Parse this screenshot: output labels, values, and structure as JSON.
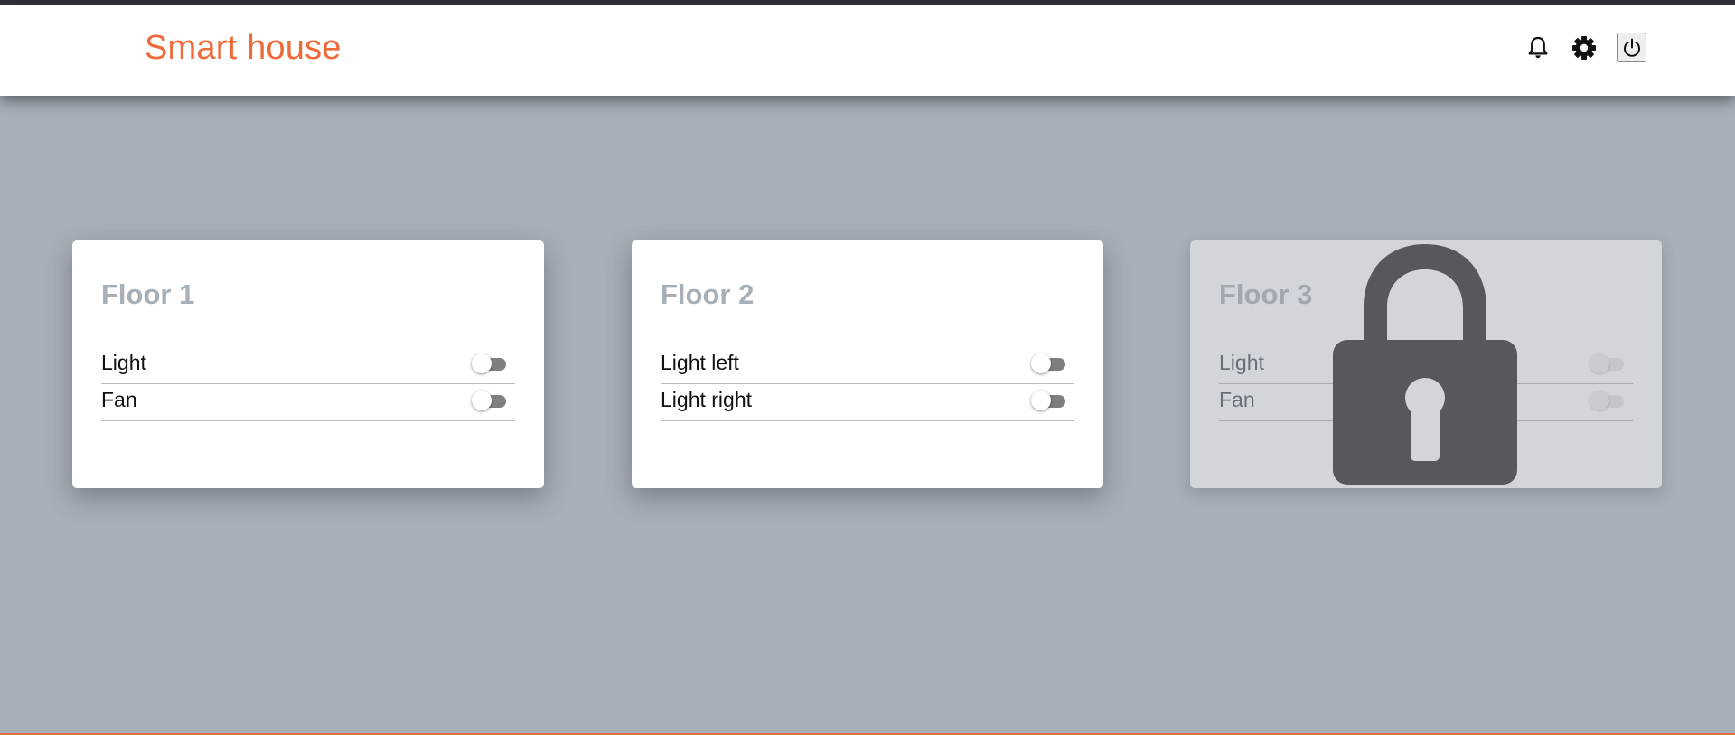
{
  "header": {
    "title": "Smart house",
    "icons": [
      "bell-icon",
      "gear-icon",
      "power-icon"
    ]
  },
  "colors": {
    "accent": "#ee6a3a",
    "background": "#a8afb7",
    "card": "#ffffff",
    "locked_card": "#d2d5da",
    "lock": "#55585d",
    "toggle_track": "#7f7f7f",
    "card_title": "#a7afb8"
  },
  "floors": [
    {
      "title": "Floor 1",
      "locked": false,
      "devices": [
        {
          "label": "Light",
          "on": false
        },
        {
          "label": "Fan",
          "on": false
        }
      ]
    },
    {
      "title": "Floor 2",
      "locked": false,
      "devices": [
        {
          "label": "Light left",
          "on": false
        },
        {
          "label": "Light right",
          "on": false
        }
      ]
    },
    {
      "title": "Floor 3",
      "locked": true,
      "lock_icon": "lock-icon",
      "devices": [
        {
          "label": "Light",
          "on": false
        },
        {
          "label": "Fan",
          "on": false
        }
      ]
    }
  ]
}
